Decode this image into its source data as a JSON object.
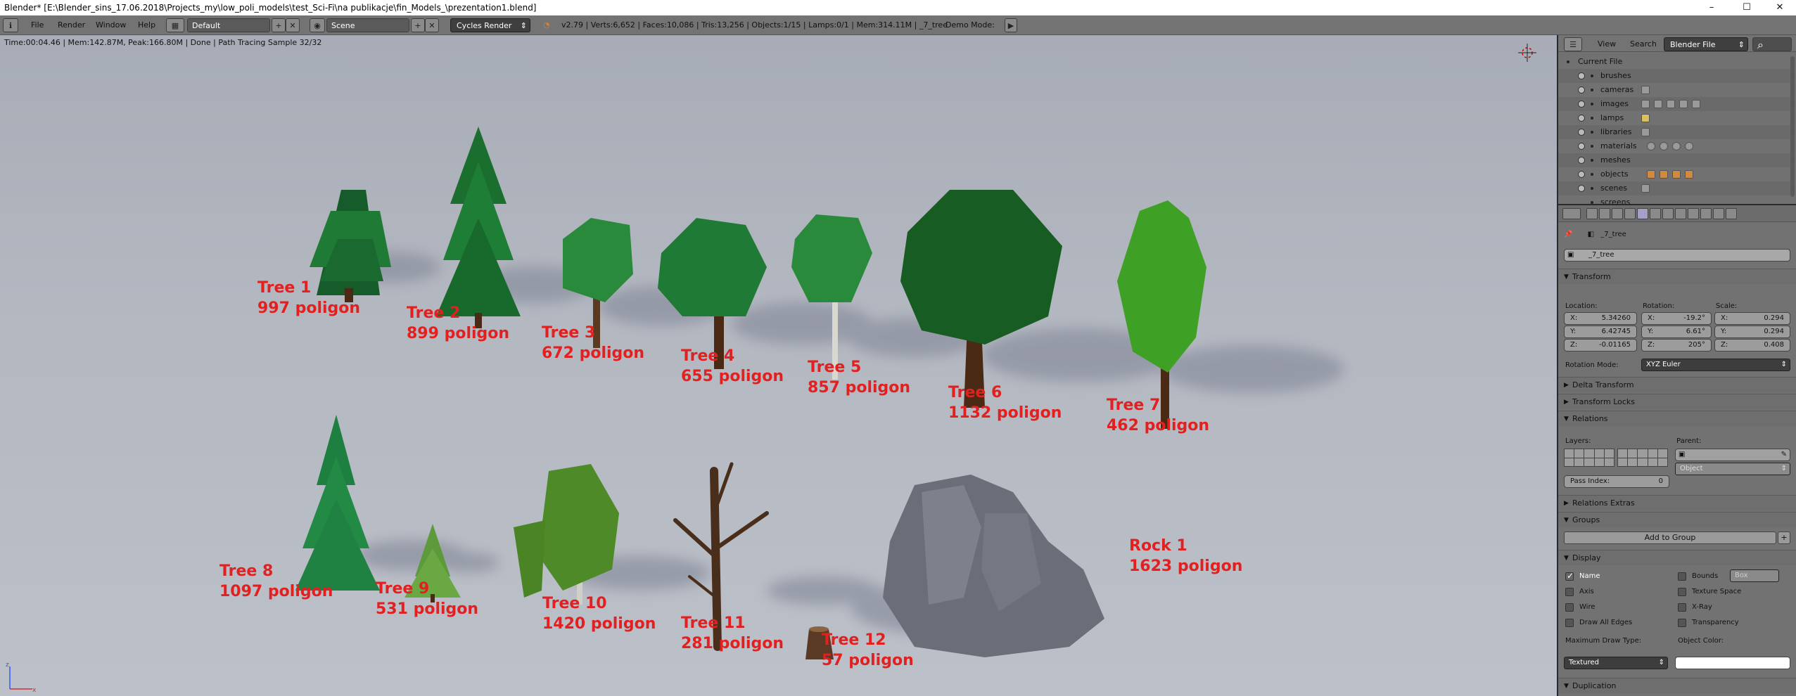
{
  "window": {
    "title": "Blender* [E:\\Blender_sins_17.06.2018\\Projects_my\\low_poli_models\\test_Sci-Fi\\na publikacje\\fin_Models_\\prezentation1.blend]",
    "minimize": "–",
    "maximize": "☐",
    "close": "✕"
  },
  "header": {
    "menus": [
      "File",
      "Render",
      "Window",
      "Help"
    ],
    "layout_value": "Default",
    "scene_value": "Scene",
    "render_engine": "Cycles Render",
    "stats": "v2.79 | Verts:6,652 | Faces:10,086 | Tris:13,256 | Objects:1/15 | Lamps:0/1 | Mem:314.11M | _7_tree",
    "demo_mode": "Demo Mode:",
    "plus": "+",
    "x": "✕"
  },
  "viewport": {
    "render_status": "Time:00:04.46 | Mem:142.87M, Peak:166.80M | Done | Path Tracing Sample 32/32",
    "labels": [
      {
        "name": "Tree 1",
        "count": "997 poligon"
      },
      {
        "name": "Tree 2",
        "count": "899 poligon"
      },
      {
        "name": "Tree 3",
        "count": "672 poligon"
      },
      {
        "name": "Tree 4",
        "count": "655 poligon"
      },
      {
        "name": "Tree 5",
        "count": "857 poligon"
      },
      {
        "name": "Tree 6",
        "count": "1132 poligon"
      },
      {
        "name": "Tree 7",
        "count": "462 poligon"
      },
      {
        "name": "Tree 8",
        "count": "1097 poligon"
      },
      {
        "name": "Tree 9",
        "count": "531 poligon"
      },
      {
        "name": "Tree 10",
        "count": "1420 poligon"
      },
      {
        "name": "Tree 11",
        "count": "281 poligon"
      },
      {
        "name": "Tree 12",
        "count": "57 poligon"
      },
      {
        "name": "Rock 1",
        "count": "1623 poligon"
      }
    ],
    "axis_x": "x",
    "axis_z": "z"
  },
  "outliner": {
    "view": "View",
    "search": "Search",
    "display_mode": "Blender File",
    "items": [
      "Current File",
      "brushes",
      "cameras",
      "images",
      "lamps",
      "libraries",
      "materials",
      "meshes",
      "objects",
      "scenes",
      "screens"
    ]
  },
  "properties": {
    "object_name_breadcrumb": "_7_tree",
    "object_name": "_7_tree",
    "sections": {
      "transform": "Transform",
      "delta": "Delta Transform",
      "locks": "Transform Locks",
      "relations": "Relations",
      "relations_extras": "Relations Extras",
      "groups": "Groups",
      "display": "Display",
      "duplication": "Duplication"
    },
    "location_label": "Location:",
    "rotation_label": "Rotation:",
    "scale_label": "Scale:",
    "location": [
      {
        "k": "X:",
        "v": "5.34260"
      },
      {
        "k": "Y:",
        "v": "6.42745"
      },
      {
        "k": "Z:",
        "v": "-0.01165"
      }
    ],
    "rotation": [
      {
        "k": "X:",
        "v": "-19.2°"
      },
      {
        "k": "Y:",
        "v": "6.61°"
      },
      {
        "k": "Z:",
        "v": "205°"
      }
    ],
    "scale": [
      {
        "k": "X:",
        "v": "0.294"
      },
      {
        "k": "Y:",
        "v": "0.294"
      },
      {
        "k": "Z:",
        "v": "0.408"
      }
    ],
    "rotation_mode_label": "Rotation Mode:",
    "rotation_mode": "XYZ Euler",
    "layers_label": "Layers:",
    "parent_label": "Parent:",
    "parent_type": "Object",
    "pass_index_label": "Pass Index:",
    "pass_index": "0",
    "add_to_group": "Add to Group",
    "display": {
      "name": "Name",
      "axis": "Axis",
      "wire": "Wire",
      "draw_all_edges": "Draw All Edges",
      "bounds": "Bounds",
      "bounds_type": "Box",
      "texture_space": "Texture Space",
      "xray": "X-Ray",
      "transparency": "Transparency",
      "max_draw_type_label": "Maximum Draw Type:",
      "max_draw_type": "Textured",
      "object_color_label": "Object Color:"
    }
  }
}
